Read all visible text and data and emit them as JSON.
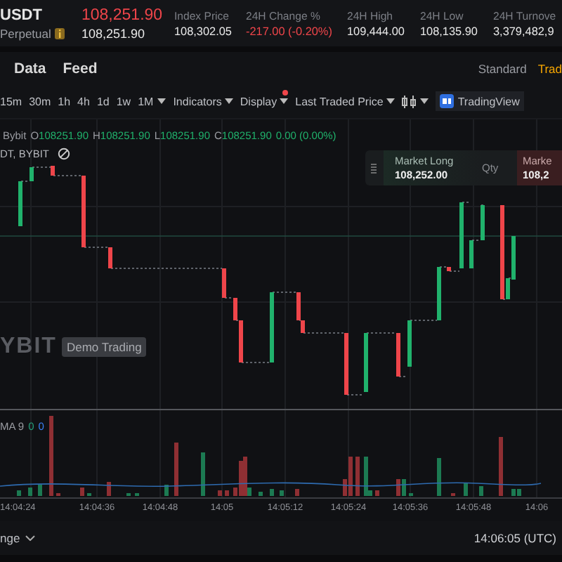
{
  "symbol": {
    "name": "USDT",
    "type": "Perpetual"
  },
  "price": {
    "last": "108,251.90",
    "mark": "108,251.90"
  },
  "stats": [
    {
      "label": "Index Price",
      "value": "108,302.05",
      "color": "#e8e8e8"
    },
    {
      "label": "24H Change %",
      "value": "-217.00 (-0.20%)",
      "color": "#ef454a"
    },
    {
      "label": "24H High",
      "value": "109,444.00",
      "color": "#e8e8e8"
    },
    {
      "label": "24H Low",
      "value": "108,135.90",
      "color": "#e8e8e8"
    },
    {
      "label": "24H Turnove",
      "value": "3,379,482,9",
      "color": "#e8e8e8"
    }
  ],
  "tabs": [
    {
      "label": "Data",
      "selected": false
    },
    {
      "label": "Feed",
      "selected": false
    }
  ],
  "view_modes": [
    {
      "label": "Standard",
      "selected": false
    },
    {
      "label": "Trad",
      "selected": true
    }
  ],
  "intervals": [
    {
      "label": "15m",
      "selected": false
    },
    {
      "label": "30m",
      "selected": false
    },
    {
      "label": "1h",
      "selected": false
    },
    {
      "label": "4h",
      "selected": false
    },
    {
      "label": "1d",
      "selected": false
    },
    {
      "label": "1w",
      "selected": false
    },
    {
      "label": "1M",
      "selected": false
    }
  ],
  "toolbar": [
    {
      "label": "Indicators",
      "notification": false
    },
    {
      "label": "Display",
      "notification": true
    },
    {
      "label": "Last Traded Price",
      "notification": false
    }
  ],
  "chart_provider": "TradingView",
  "legend": {
    "exchange": "Bybit",
    "values": [
      {
        "key": "O",
        "value": "108251.90"
      },
      {
        "key": "H",
        "value": "108251.90"
      },
      {
        "key": "L",
        "value": "108251.90"
      },
      {
        "key": "C",
        "value": "108251.90"
      }
    ],
    "change": "0.00 (0.00%)"
  },
  "series_title": "DT, BYBIT",
  "watermark": {
    "brand": "YBIT",
    "badge": "Demo Trading"
  },
  "order_panel": {
    "long_label": "Market Long",
    "long_price": "108,252.00",
    "qty_label": "Qty",
    "short_label": "Marke",
    "short_price": "108,2"
  },
  "volume": {
    "label": "MA 9",
    "values": [
      {
        "value": "0",
        "color": "#26a17b"
      },
      {
        "value": "0",
        "color": "#3b82f6"
      }
    ]
  },
  "time_axis": [
    "14:04:24",
    "14:04:36",
    "14:04:48",
    "14:05",
    "14:05:12",
    "14:05:24",
    "14:05:36",
    "14:05:48",
    "14:06"
  ],
  "bottom_bar": {
    "range": "nge",
    "time": "14:06:05 (UTC)"
  }
}
